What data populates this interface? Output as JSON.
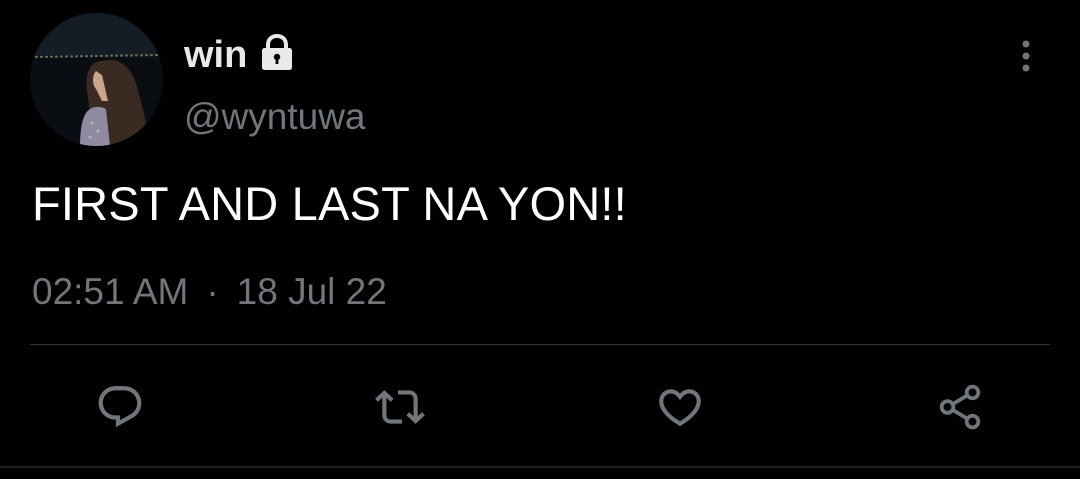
{
  "user": {
    "display_name": "win",
    "handle": "@wyntuwa",
    "protected_icon": "lock-icon",
    "avatar_icon": "profile-photo"
  },
  "tweet": {
    "text": "FIRST AND LAST NA YON!!",
    "time": "02:51 AM",
    "separator": "·",
    "date": "18 Jul 22"
  },
  "actions": [
    {
      "name": "reply",
      "icon": "reply-icon"
    },
    {
      "name": "retweet",
      "icon": "retweet-icon"
    },
    {
      "name": "like",
      "icon": "heart-icon"
    },
    {
      "name": "share",
      "icon": "share-icon"
    }
  ],
  "menu": {
    "icon": "more-vertical-icon"
  },
  "colors": {
    "background": "#000000",
    "primary_text": "#e7e9ea",
    "secondary_text": "#71767b",
    "divider": "#2f3336"
  }
}
